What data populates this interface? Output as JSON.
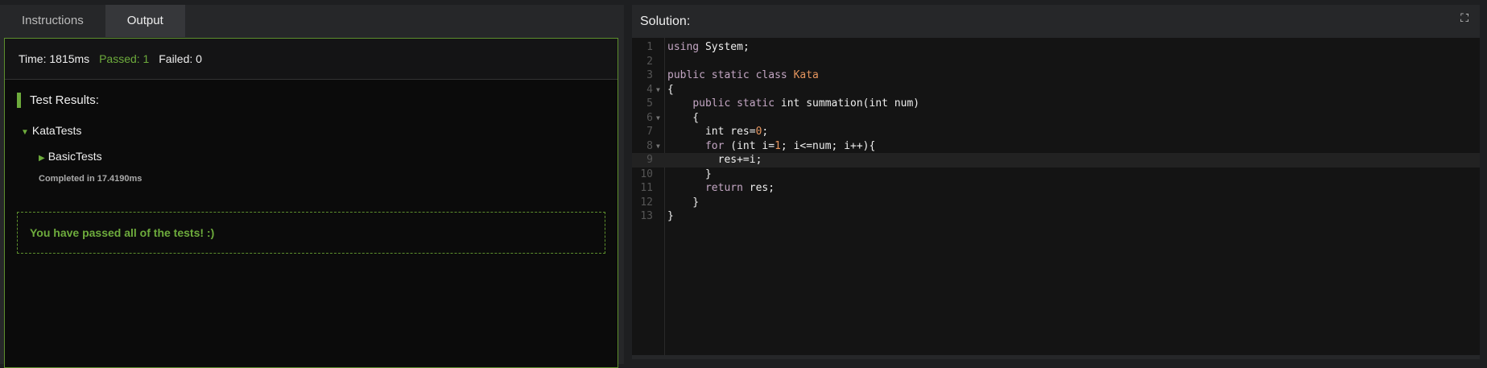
{
  "tabs": [
    {
      "label": "Instructions",
      "active": false
    },
    {
      "label": "Output",
      "active": true
    }
  ],
  "status": {
    "time": "Time: 1815ms",
    "passed": "Passed: 1",
    "failed": "Failed: 0"
  },
  "results": {
    "heading": "Test Results:",
    "suite": "KataTests",
    "subsuite": "BasicTests",
    "completed": "Completed in 17.4190ms",
    "message": "You have passed all of the tests! :)"
  },
  "solution": {
    "title": "Solution:",
    "expand_icon": "expand-icon"
  },
  "code": [
    "using System;",
    "",
    "public static class Kata",
    "{",
    "    public static int summation(int num)",
    "    {",
    "      int res=0;",
    "      for (int i=1; i<=num; i++){",
    "        res+=i;",
    "      }",
    "      return res;",
    "    }",
    "}"
  ],
  "colors": {
    "accent": "#6dab3c",
    "keyword": "#c3a6c3",
    "class": "#e5955e"
  }
}
